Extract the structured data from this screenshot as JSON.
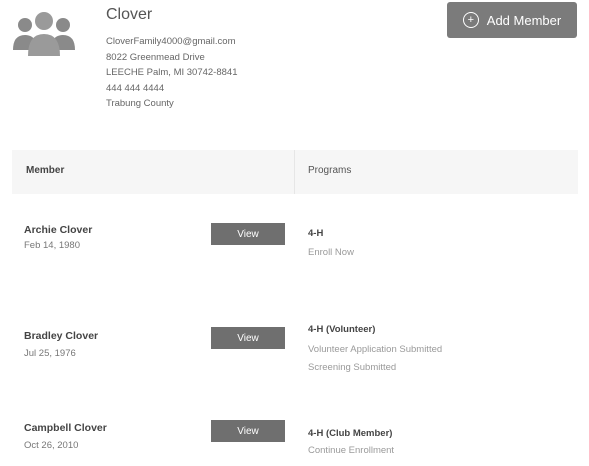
{
  "family": {
    "name": "Clover",
    "details": [
      "CloverFamily4000@gmail.com",
      "8022 Greenmead Drive",
      "LEECHE Palm, MI 30742-8841",
      "444 444 4444",
      "Trabung County"
    ]
  },
  "toolbar": {
    "add_member_label": "Add Member"
  },
  "table": {
    "member_header": "Member",
    "programs_header": "Programs"
  },
  "members": [
    {
      "name": "Archie Clover",
      "dob": "Feb 14, 1980",
      "view_label": "View",
      "program_title": "4-H",
      "program_lines": [
        "Enroll Now"
      ]
    },
    {
      "name": "Bradley Clover",
      "dob": "Jul 25, 1976",
      "view_label": "View",
      "program_title": "4-H (Volunteer)",
      "program_lines": [
        "Volunteer Application Submitted",
        "Screening Submitted"
      ]
    },
    {
      "name": "Campbell Clover",
      "dob": "Oct 26, 2010",
      "view_label": "View",
      "program_title": "4-H (Club Member)",
      "program_lines": [
        "Continue Enrollment"
      ]
    }
  ]
}
